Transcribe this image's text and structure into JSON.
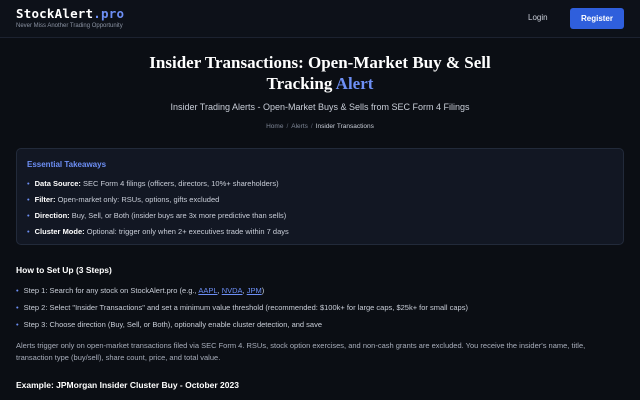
{
  "header": {
    "logo_main": "StockAlert",
    "logo_suffix": ".pro",
    "tagline": "Never Miss Another Trading Opportunity",
    "login_label": "Login",
    "register_label": "Register"
  },
  "hero": {
    "title_main": "Insider Transactions: Open-Market Buy & Sell Tracking",
    "title_accent": "Alert",
    "subtitle": "Insider Trading Alerts - Open-Market Buys & Sells from SEC Form 4 Filings"
  },
  "breadcrumb": {
    "items": [
      "Home",
      "Alerts",
      "Insider Transactions"
    ],
    "separator": "/"
  },
  "takeaways": {
    "title": "Essential Takeaways",
    "items": [
      {
        "label": "Data Source:",
        "text": "SEC Form 4 filings (officers, directors, 10%+ shareholders)"
      },
      {
        "label": "Filter:",
        "text": "Open-market only: RSUs, options, gifts excluded"
      },
      {
        "label": "Direction:",
        "text": "Buy, Sell, or Both (insider buys are 3x more predictive than sells)"
      },
      {
        "label": "Cluster Mode:",
        "text": "Optional: trigger only when 2+ executives trade within 7 days"
      }
    ]
  },
  "setup": {
    "title": "How to Set Up (3 Steps)",
    "step1_prefix": "Step 1: Search for any stock on StockAlert.pro (e.g.,",
    "step1_links": [
      "AAPL",
      "NVDA",
      "JPM"
    ],
    "step1_suffix": ")",
    "step2": "Step 2: Select \"Insider Transactions\" and set a minimum value threshold (recommended: $100k+ for large caps, $25k+ for small caps)",
    "step3": "Step 3: Choose direction (Buy, Sell, or Both), optionally enable cluster detection, and save",
    "paragraph": "Alerts trigger only on open-market transactions filed via SEC Form 4. RSUs, stock option exercises, and non-cash grants are excluded. You receive the insider's name, title, transaction type (buy/sell), share count, price, and total value."
  },
  "example": {
    "title": "Example: JPMorgan Insider Cluster Buy - October 2023"
  },
  "colors": {
    "background": "#0b0e14",
    "accent": "#6d8ff5",
    "register_button": "#2f5fdc",
    "card": "#121723"
  }
}
